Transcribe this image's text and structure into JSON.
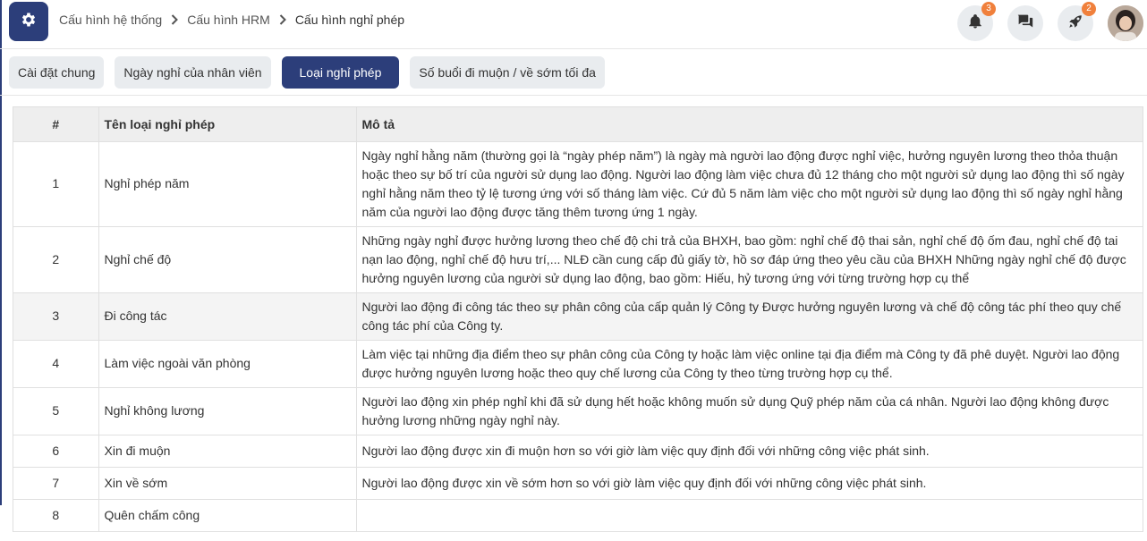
{
  "header": {
    "breadcrumb": [
      "Cấu hình hệ thống",
      "Cấu hình HRM",
      "Cấu hình nghỉ phép"
    ],
    "notifications_count": "3",
    "rocket_count": "2",
    "icons": [
      "gear-icon",
      "bell-icon",
      "chat-icon",
      "rocket-icon",
      "avatar"
    ]
  },
  "tabs": [
    {
      "label": "Cài đặt chung",
      "active": false
    },
    {
      "label": "Ngày nghỉ của nhân viên",
      "active": false
    },
    {
      "label": "Loại nghỉ phép",
      "active": true
    },
    {
      "label": "Số buổi đi muộn / về sớm tối đa",
      "active": false
    }
  ],
  "table": {
    "headers": [
      "#",
      "Tên loại nghỉ phép",
      "Mô tả"
    ],
    "rows": [
      {
        "num": "1",
        "name": "Nghỉ phép năm",
        "desc": "Ngày nghỉ hằng năm (thường gọi là “ngày phép năm”) là ngày mà người lao động được nghỉ việc, hưởng nguyên lương theo thỏa thuận hoặc theo sự bố trí của người sử dụng lao động. Người lao động làm việc chưa đủ 12 tháng cho một người sử dụng lao động thì số ngày nghỉ hằng năm theo tỷ lệ tương ứng với số tháng làm việc. Cứ đủ 5 năm làm việc cho một người sử dụng lao động thì số ngày nghỉ hằng năm của người lao động được tăng thêm tương ứng 1 ngày."
      },
      {
        "num": "2",
        "name": "Nghỉ chế độ",
        "desc": "Những ngày nghỉ được hưởng lương theo chế độ chi trả của BHXH, bao gồm: nghỉ chế độ thai sản, nghỉ chế độ ốm đau, nghỉ chế độ tai nạn lao động, nghỉ chế độ hưu trí,... NLĐ cần cung cấp đủ giấy tờ, hồ sơ đáp ứng theo yêu cầu của BHXH Những ngày nghỉ chế độ được hưởng nguyên lương của người sử dụng lao động, bao gồm: Hiếu, hỷ tương ứng với từng trường hợp cụ thể"
      },
      {
        "num": "3",
        "name": "Đi công tác",
        "desc": "Người lao động đi công tác theo sự phân công của cấp quản lý Công ty Được hưởng nguyên lương và chế độ công tác phí theo quy chế công tác phí của Công ty."
      },
      {
        "num": "4",
        "name": "Làm việc ngoài văn phòng",
        "desc": "Làm việc tại những địa điểm theo sự phân công của Công ty hoặc làm việc online tại địa điểm mà Công ty đã phê duyệt. Người lao động được hưởng nguyên lương hoặc theo quy chế lương của Công ty theo từng trường hợp cụ thể."
      },
      {
        "num": "5",
        "name": "Nghỉ không lương",
        "desc": "Người lao động xin phép nghỉ khi đã sử dụng hết hoặc không muốn sử dụng Quỹ phép năm của cá nhân. Người lao động không được hưởng lương những ngày nghỉ này."
      },
      {
        "num": "6",
        "name": "Xin đi muộn",
        "desc": "Người lao động được xin đi muộn hơn so với giờ làm việc quy định đối với những công việc phát sinh."
      },
      {
        "num": "7",
        "name": "Xin về sớm",
        "desc": "Người lao động được xin về sớm hơn so với giờ làm việc quy định đối với những công việc phát sinh."
      },
      {
        "num": "8",
        "name": "Quên chấm công",
        "desc": ""
      }
    ]
  }
}
